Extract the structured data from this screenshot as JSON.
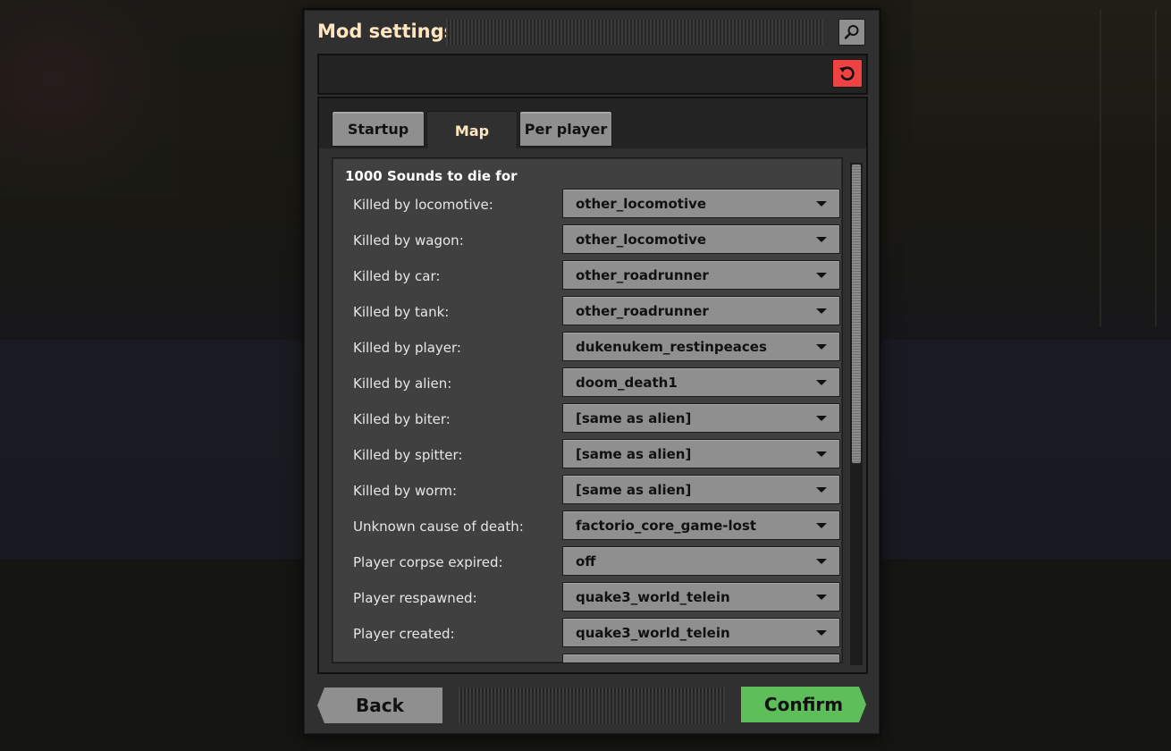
{
  "window": {
    "title": "Mod settings"
  },
  "toolbar": {
    "search_icon": "search-icon",
    "reset_icon": "reset-icon",
    "reset_color": "#ef4242"
  },
  "tabs": [
    {
      "label": "Startup",
      "active": false
    },
    {
      "label": "Map",
      "active": true
    },
    {
      "label": "Per player",
      "active": false
    }
  ],
  "section": {
    "title": "1000 Sounds to die for",
    "settings": [
      {
        "label": "Killed by locomotive:",
        "value": "other_locomotive"
      },
      {
        "label": "Killed by wagon:",
        "value": "other_locomotive"
      },
      {
        "label": "Killed by car:",
        "value": "other_roadrunner"
      },
      {
        "label": "Killed by tank:",
        "value": "other_roadrunner"
      },
      {
        "label": "Killed by player:",
        "value": "dukenukem_restinpeaces"
      },
      {
        "label": "Killed by alien:",
        "value": "doom_death1"
      },
      {
        "label": "Killed by biter:",
        "value": "[same as alien]"
      },
      {
        "label": "Killed by spitter:",
        "value": "[same as alien]"
      },
      {
        "label": "Killed by worm:",
        "value": "[same as alien]"
      },
      {
        "label": "Unknown cause of death:",
        "value": "factorio_core_game-lost"
      },
      {
        "label": "Player corpse expired:",
        "value": "off"
      },
      {
        "label": "Player respawned:",
        "value": "quake3_world_telein"
      },
      {
        "label": "Player created:",
        "value": "quake3_world_telein"
      }
    ]
  },
  "footer": {
    "back_label": "Back",
    "confirm_label": "Confirm",
    "confirm_color": "#5dbe5a"
  }
}
